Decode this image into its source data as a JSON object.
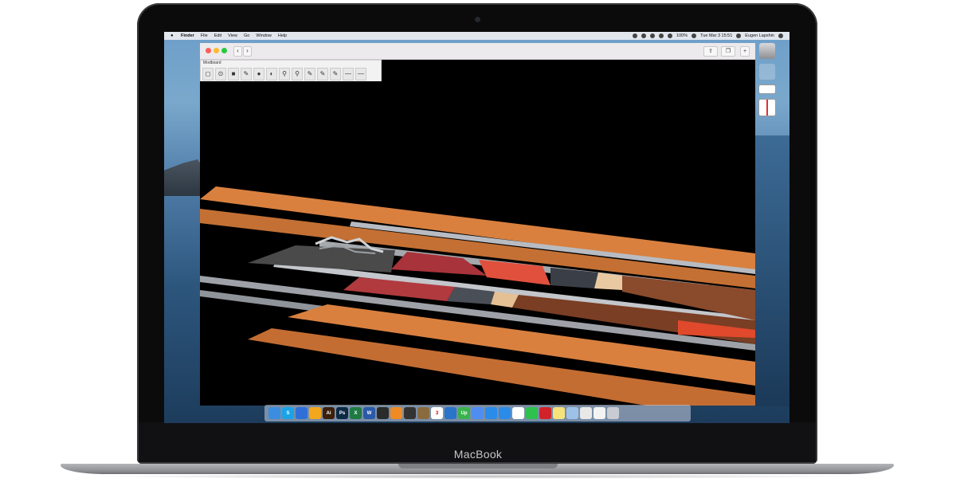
{
  "device": {
    "brand": "MacBook"
  },
  "menubar": {
    "apple_icon": "apple-icon",
    "items": [
      "Finder",
      "File",
      "Edit",
      "View",
      "Go",
      "Window",
      "Help"
    ],
    "battery": "100%",
    "datetime": "Tue Mar 3 15:51",
    "user": "Eugen Lapshin"
  },
  "desktop": {
    "icons": [
      {
        "name": "hard-drive-icon",
        "caption": ""
      },
      {
        "name": "folder-icon",
        "caption": ""
      },
      {
        "name": "screenshot-file-icon",
        "caption": ""
      },
      {
        "name": "screenshot-file-icon-2",
        "caption": ""
      }
    ]
  },
  "window": {
    "nav_back": "‹",
    "nav_forward": "›",
    "toolbox_title": "Modboard",
    "tools": [
      "◻",
      "⊙",
      "■",
      "✎",
      "●",
      "◐",
      "⚲",
      "⚲",
      "✎",
      "✎",
      "✎",
      "—",
      "—"
    ]
  },
  "dock": {
    "apps": [
      {
        "name": "finder-icon",
        "color": "#3b8de0",
        "label": ""
      },
      {
        "name": "skype-icon",
        "color": "#1aa3e8",
        "label": "S"
      },
      {
        "name": "safari-icon",
        "color": "#2f6fd8",
        "label": ""
      },
      {
        "name": "sketch-icon",
        "color": "#f3a71d",
        "label": ""
      },
      {
        "name": "illustrator-icon",
        "color": "#3c1f0a",
        "label": "Ai"
      },
      {
        "name": "photoshop-icon",
        "color": "#0c2a44",
        "label": "Ps"
      },
      {
        "name": "excel-icon",
        "color": "#1e7a44",
        "label": "X"
      },
      {
        "name": "word-icon",
        "color": "#2b5aa8",
        "label": "W"
      },
      {
        "name": "figma-icon",
        "color": "#2b2b2b",
        "label": ""
      },
      {
        "name": "thing-icon",
        "color": "#f08a24",
        "label": ""
      },
      {
        "name": "terminal-icon",
        "color": "#333333",
        "label": ""
      },
      {
        "name": "notes-icon",
        "color": "#8a6b3f",
        "label": ""
      },
      {
        "name": "calendar-icon",
        "color": "#ffffff",
        "label": "3"
      },
      {
        "name": "xcode-icon",
        "color": "#2a74c9",
        "label": ""
      },
      {
        "name": "upwork-icon",
        "color": "#37b34a",
        "label": "Up"
      },
      {
        "name": "music-icon",
        "color": "#4f8ef0",
        "label": ""
      },
      {
        "name": "appstore-icon",
        "color": "#2a8be8",
        "label": ""
      },
      {
        "name": "messages-icon",
        "color": "#2a8be8",
        "label": ""
      },
      {
        "name": "slack-icon",
        "color": "#ffffff",
        "label": ""
      },
      {
        "name": "whatsapp-icon",
        "color": "#2ec24d",
        "label": ""
      },
      {
        "name": "opera-icon",
        "color": "#d12229",
        "label": ""
      },
      {
        "name": "stickies-icon",
        "color": "#f5e27a",
        "label": ""
      },
      {
        "name": "mail-folder-icon",
        "color": "#9ec1e8",
        "label": ""
      },
      {
        "name": "preview-icon",
        "color": "#e8e8e8",
        "label": ""
      },
      {
        "name": "doc-icon",
        "color": "#f3f3f3",
        "label": ""
      },
      {
        "name": "trash-icon",
        "color": "#c8ccd2",
        "label": ""
      }
    ]
  }
}
